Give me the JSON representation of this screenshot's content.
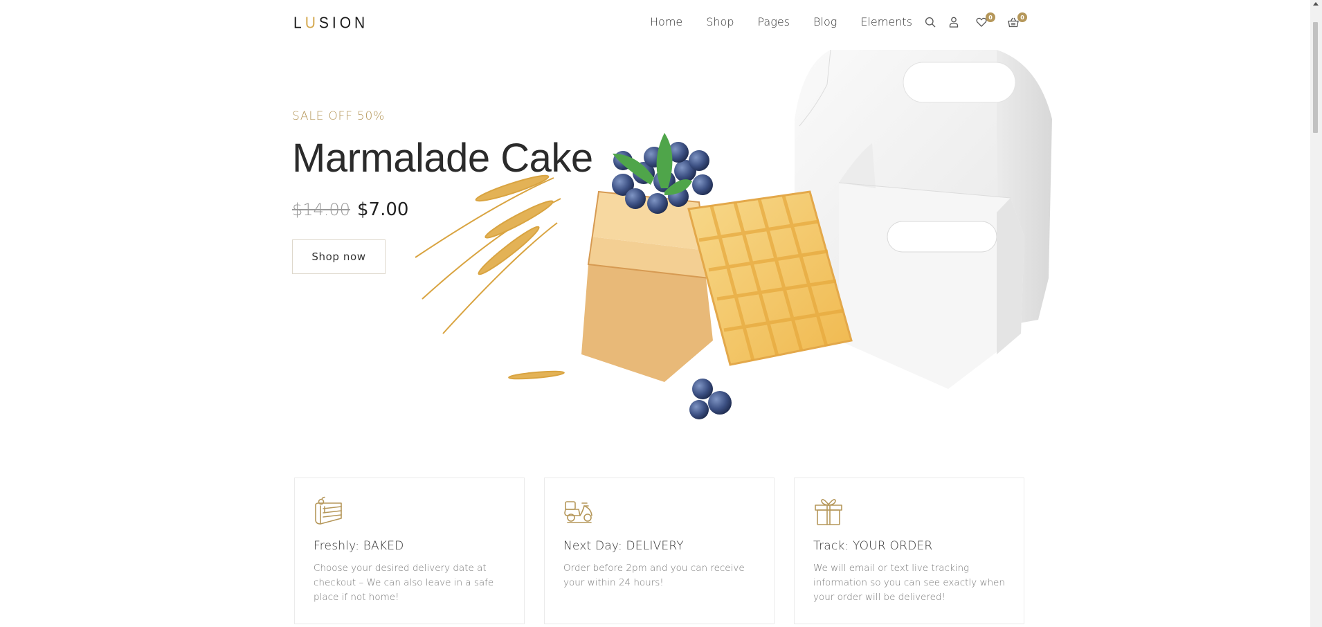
{
  "header": {
    "logo": {
      "prefix": "L",
      "accent": "U",
      "suffix": "SION"
    },
    "nav": [
      {
        "label": "Home"
      },
      {
        "label": "Shop"
      },
      {
        "label": "Pages"
      },
      {
        "label": "Blog"
      },
      {
        "label": "Elements"
      }
    ],
    "icons": {
      "search": "search-icon",
      "account": "user-icon",
      "wishlist": "heart-icon",
      "cart": "basket-icon"
    },
    "wishlist_count": "0",
    "cart_count": "0"
  },
  "hero": {
    "sale_label": "SALE OFF 50%",
    "title": "Marmalade Cake",
    "old_price": "$14.00",
    "new_price": "$7.00",
    "cta_label": "Shop now",
    "image_alt": "Waffles with blueberries, wheat and white cake boxes"
  },
  "features": [
    {
      "icon": "cake-slice-icon",
      "title": "Freshly: BAKED",
      "text": "Choose your desired delivery date at checkout – We can also leave in a safe place if not home!"
    },
    {
      "icon": "scooter-icon",
      "title": "Next Day: DELIVERY",
      "text": "Order before 2pm and you can receive your within 24 hours!"
    },
    {
      "icon": "gift-icon",
      "title": "Track: YOUR ORDER",
      "text": "We will email or text live tracking information so you can see exactly when your order will be delivered!"
    }
  ],
  "colors": {
    "accent": "#b5975a",
    "logo_accent": "#d4a84e",
    "text_dark": "#2b2b2b",
    "text_muted": "#777777",
    "card_border": "#ebebeb"
  }
}
